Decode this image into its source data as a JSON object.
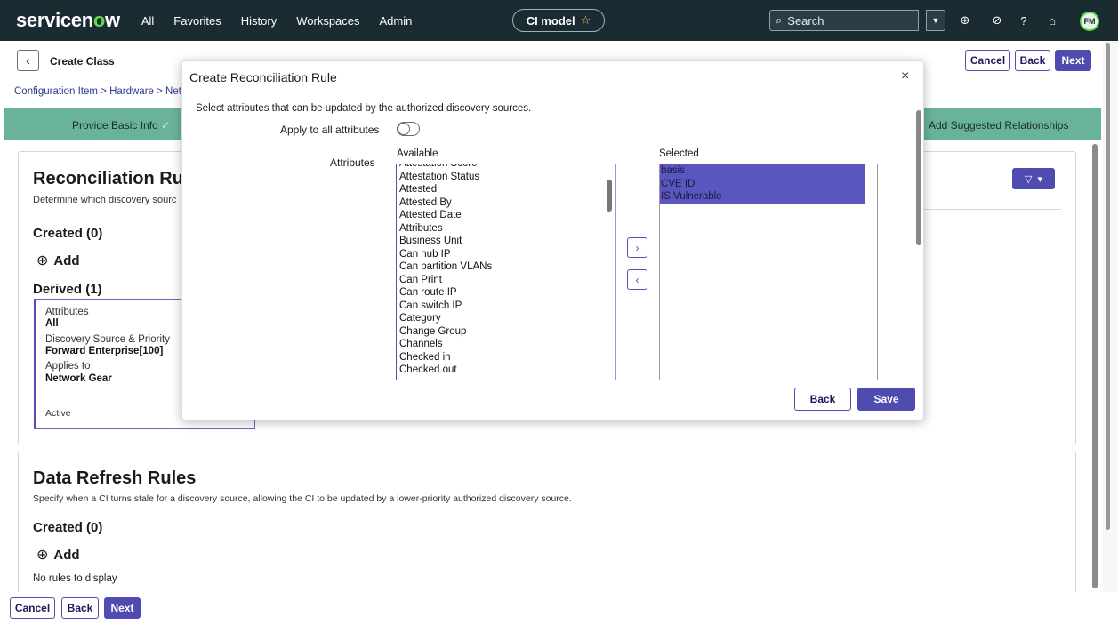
{
  "nav": {
    "logo_prefix": "servicen",
    "logo_o": "o",
    "logo_suffix": "w",
    "links": [
      "All",
      "Favorites",
      "History",
      "Workspaces",
      "Admin"
    ],
    "context_pill": "CI model",
    "search_placeholder": "Search",
    "user_initials": "FM"
  },
  "header": {
    "title": "Create Class",
    "cancel_label": "Cancel",
    "back_label": "Back",
    "next_label": "Next"
  },
  "breadcrumb": "Configuration Item > Hardware > Net",
  "progress": {
    "step1": "Provide Basic Info",
    "step1_check": "✓",
    "step_last": "Add Suggested Relationships"
  },
  "reconciliation": {
    "title": "Reconciliation Rule",
    "description": "Determine which discovery sourc",
    "created_heading": "Created (0)",
    "add_label": "Add",
    "derived_heading": "Derived (1)",
    "rule": {
      "attributes_label": "Attributes",
      "attributes_value": "All",
      "source_label": "Discovery Source & Priority",
      "source_value": "Forward Enterprise[100]",
      "applies_label": "Applies to",
      "applies_value": "Network Gear",
      "status": "Active"
    }
  },
  "data_refresh": {
    "title": "Data Refresh Rules",
    "description": "Specify when a CI turns stale for a discovery source, allowing the CI to be updated by a lower-priority authorized discovery source.",
    "created_heading": "Created (0)",
    "add_label": "Add",
    "empty": "No rules to display"
  },
  "footer": {
    "cancel_label": "Cancel",
    "back_label": "Back",
    "next_label": "Next"
  },
  "modal": {
    "title": "Create Reconciliation Rule",
    "close": "×",
    "instruction": "Select attributes that can be updated by the authorized discovery sources.",
    "apply_all_label": "Apply to all attributes",
    "apply_all_on": false,
    "attributes_label": "Attributes",
    "available_label": "Available",
    "selected_label": "Selected",
    "available": [
      "Attestation Score",
      "Attestation Status",
      "Attested",
      "Attested By",
      "Attested Date",
      "Attributes",
      "Business Unit",
      "Can hub IP",
      "Can partition VLANs",
      "Can Print",
      "Can route IP",
      "Can switch IP",
      "Category",
      "Change Group",
      "Channels",
      "Checked in",
      "Checked out"
    ],
    "selected": [
      "basis",
      "CVE ID",
      "IS Vulnerable"
    ],
    "move_right": "›",
    "move_left": "‹",
    "back_label": "Back",
    "save_label": "Save"
  },
  "colors": {
    "nav_bg": "#1a2b32",
    "accent": "#4f4bb0",
    "progress_bg": "#69b499",
    "logo_accent": "#62d84e"
  }
}
